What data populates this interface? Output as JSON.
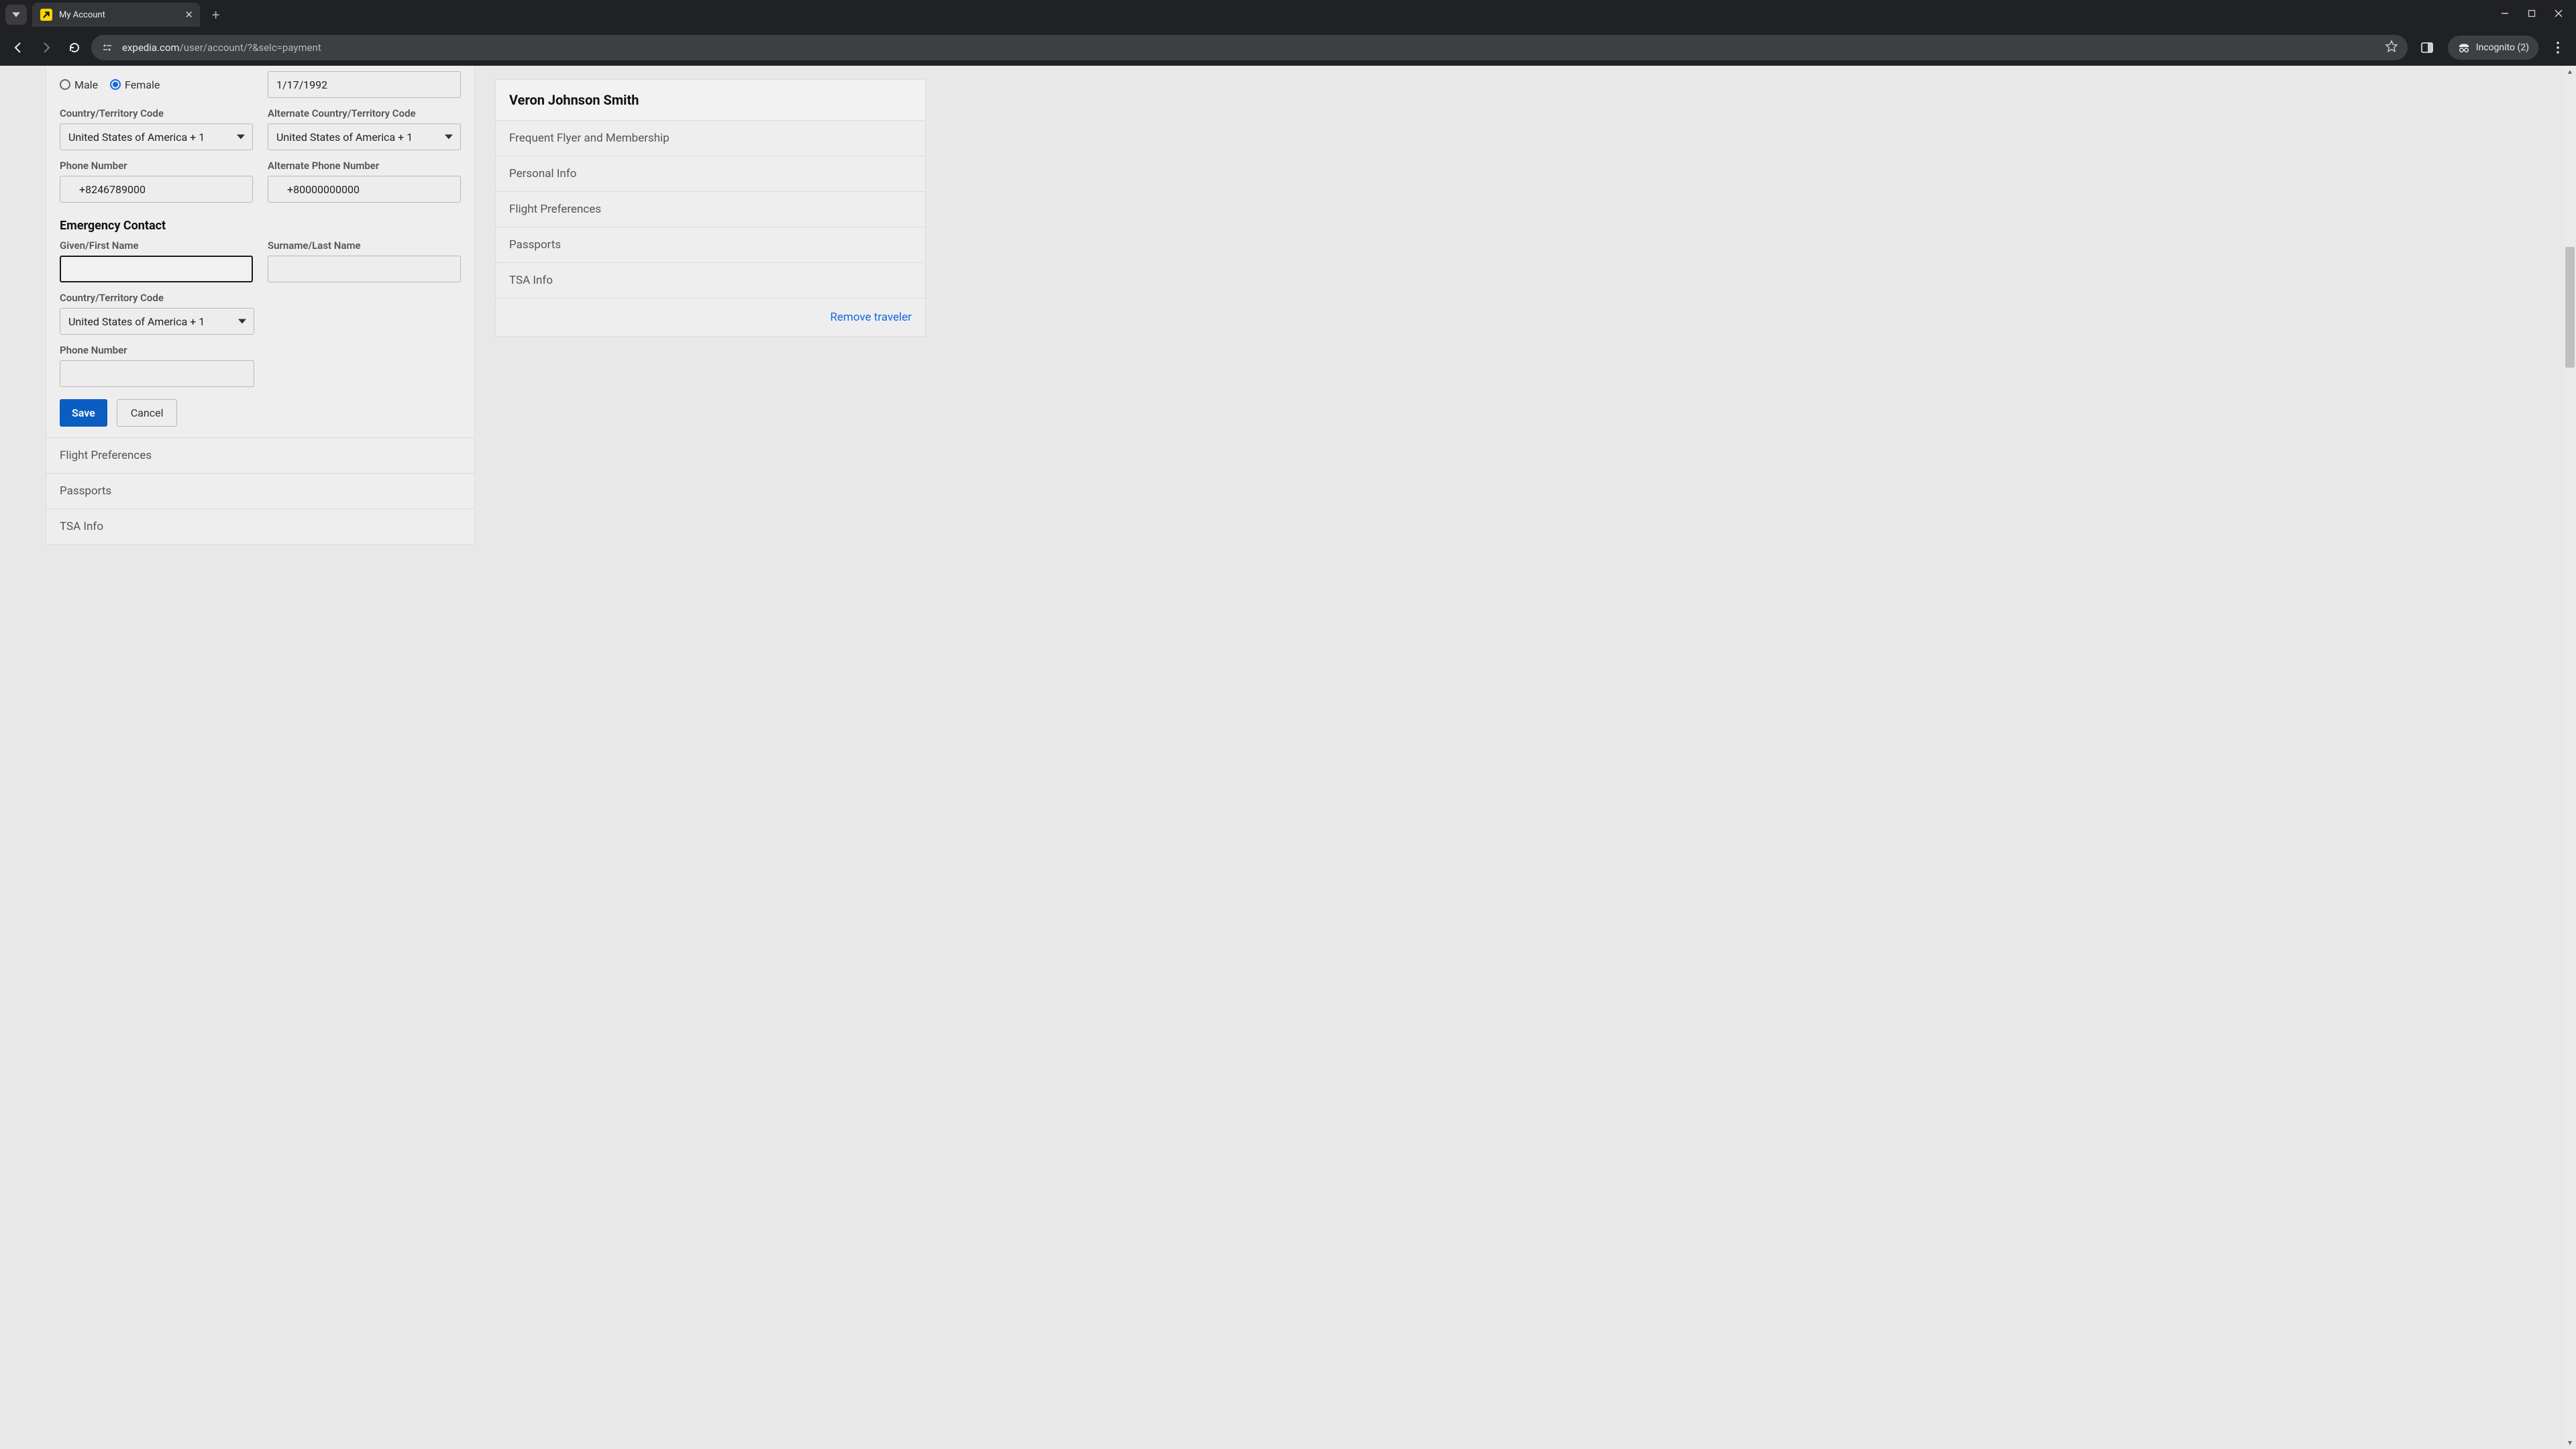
{
  "browser": {
    "tab_title": "My Account",
    "url_host": "expedia.com",
    "url_path": "/user/account/?&selc=payment",
    "incognito_label": "Incognito (2)"
  },
  "form": {
    "gender": {
      "male_label": "Male",
      "female_label": "Female",
      "selected": "female"
    },
    "dob_value": "1/17/1992",
    "country_code_label": "Country/Territory Code",
    "alt_country_code_label": "Alternate Country/Territory Code",
    "country_code_value": "United States of America + 1",
    "alt_country_code_value": "United States of America + 1",
    "phone_label": "Phone Number",
    "alt_phone_label": "Alternate Phone Number",
    "phone_value": "+8246789000",
    "alt_phone_value": "+80000000000",
    "emergency_title": "Emergency Contact",
    "emergency_first_label": "Given/First Name",
    "emergency_last_label": "Surname/Last Name",
    "emergency_first_value": "",
    "emergency_last_value": "",
    "emergency_country_code_label": "Country/Territory Code",
    "emergency_country_code_value": "United States of America + 1",
    "emergency_phone_label": "Phone Number",
    "emergency_phone_value": "",
    "save_label": "Save",
    "cancel_label": "Cancel",
    "accordion": {
      "flight_prefs": "Flight Preferences",
      "passports": "Passports",
      "tsa": "TSA Info"
    }
  },
  "side": {
    "traveler_name": "Veron Johnson Smith",
    "rows": {
      "ff": "Frequent Flyer and Membership",
      "personal": "Personal Info",
      "flight_prefs": "Flight Preferences",
      "passports": "Passports",
      "tsa": "TSA Info"
    },
    "remove_label": "Remove traveler"
  }
}
